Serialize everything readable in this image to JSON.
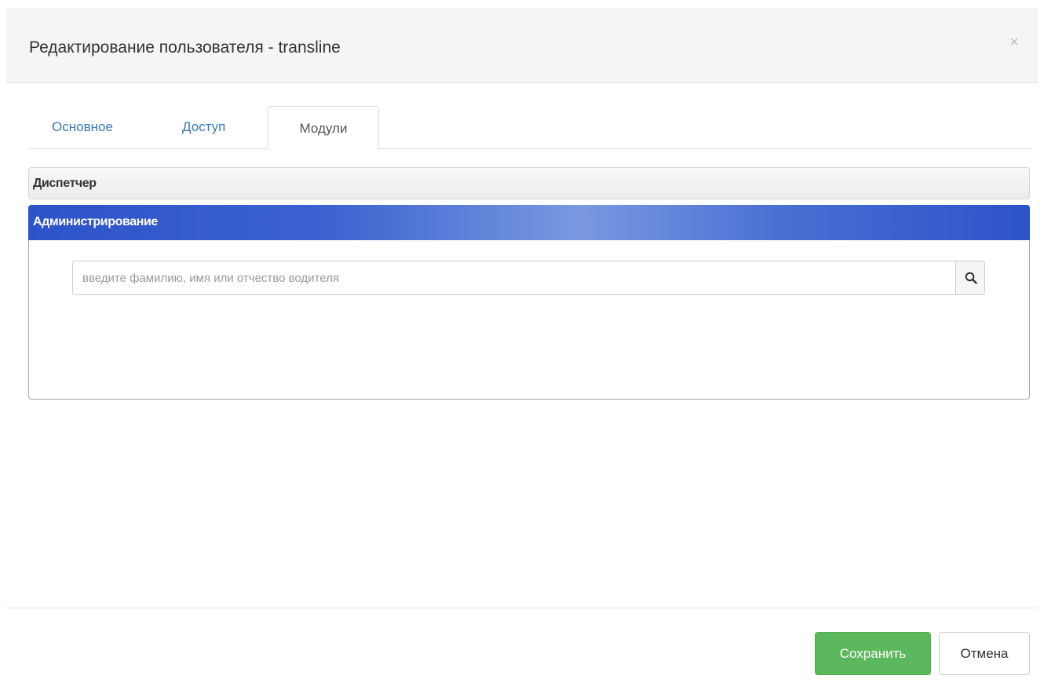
{
  "dialog": {
    "title": "Редактирование пользователя - transline",
    "close_symbol": "×"
  },
  "tabs": [
    {
      "label": "Основное",
      "active": false
    },
    {
      "label": "Доступ",
      "active": false
    },
    {
      "label": "Модули",
      "active": true
    }
  ],
  "modules": {
    "dispatcher": {
      "label": "Диспетчер",
      "expanded": false
    },
    "administration": {
      "label": "Администрирование",
      "expanded": true
    }
  },
  "search": {
    "placeholder": "введите фамилию, имя или отчество водителя",
    "value": "",
    "icon": "search-icon"
  },
  "footer": {
    "save_label": "Сохранить",
    "cancel_label": "Отмена"
  },
  "colors": {
    "save_button": "#5cb85c",
    "tab_link": "#337ab7",
    "admin_header": "#2d53c9"
  }
}
